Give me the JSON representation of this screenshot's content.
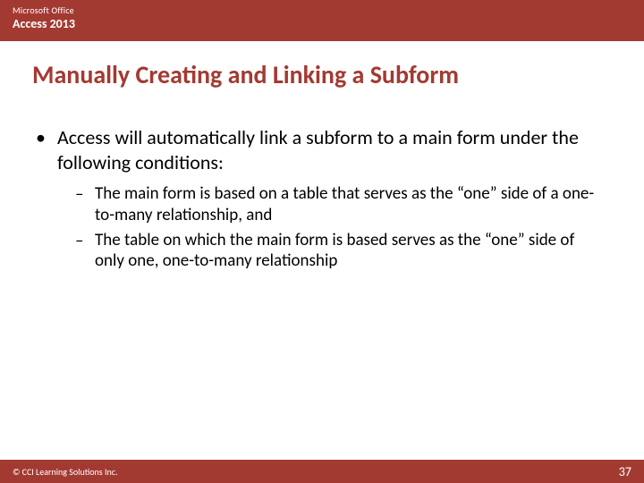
{
  "header": {
    "small": "Microsoft Office",
    "large": "Access 2013"
  },
  "title": "Manually Creating and Linking a Subform",
  "bullets": [
    {
      "text": "Access will automatically link a subform to a main form under the following conditions:",
      "subs": [
        "The main form is based on a table that serves as the “one” side of a one-to-many relationship, and",
        "The table on which the main form is based serves as the “one” side of only one, one-to-many relationship"
      ]
    }
  ],
  "footer": {
    "copyright": "© CCI Learning Solutions Inc.",
    "page": "37"
  }
}
